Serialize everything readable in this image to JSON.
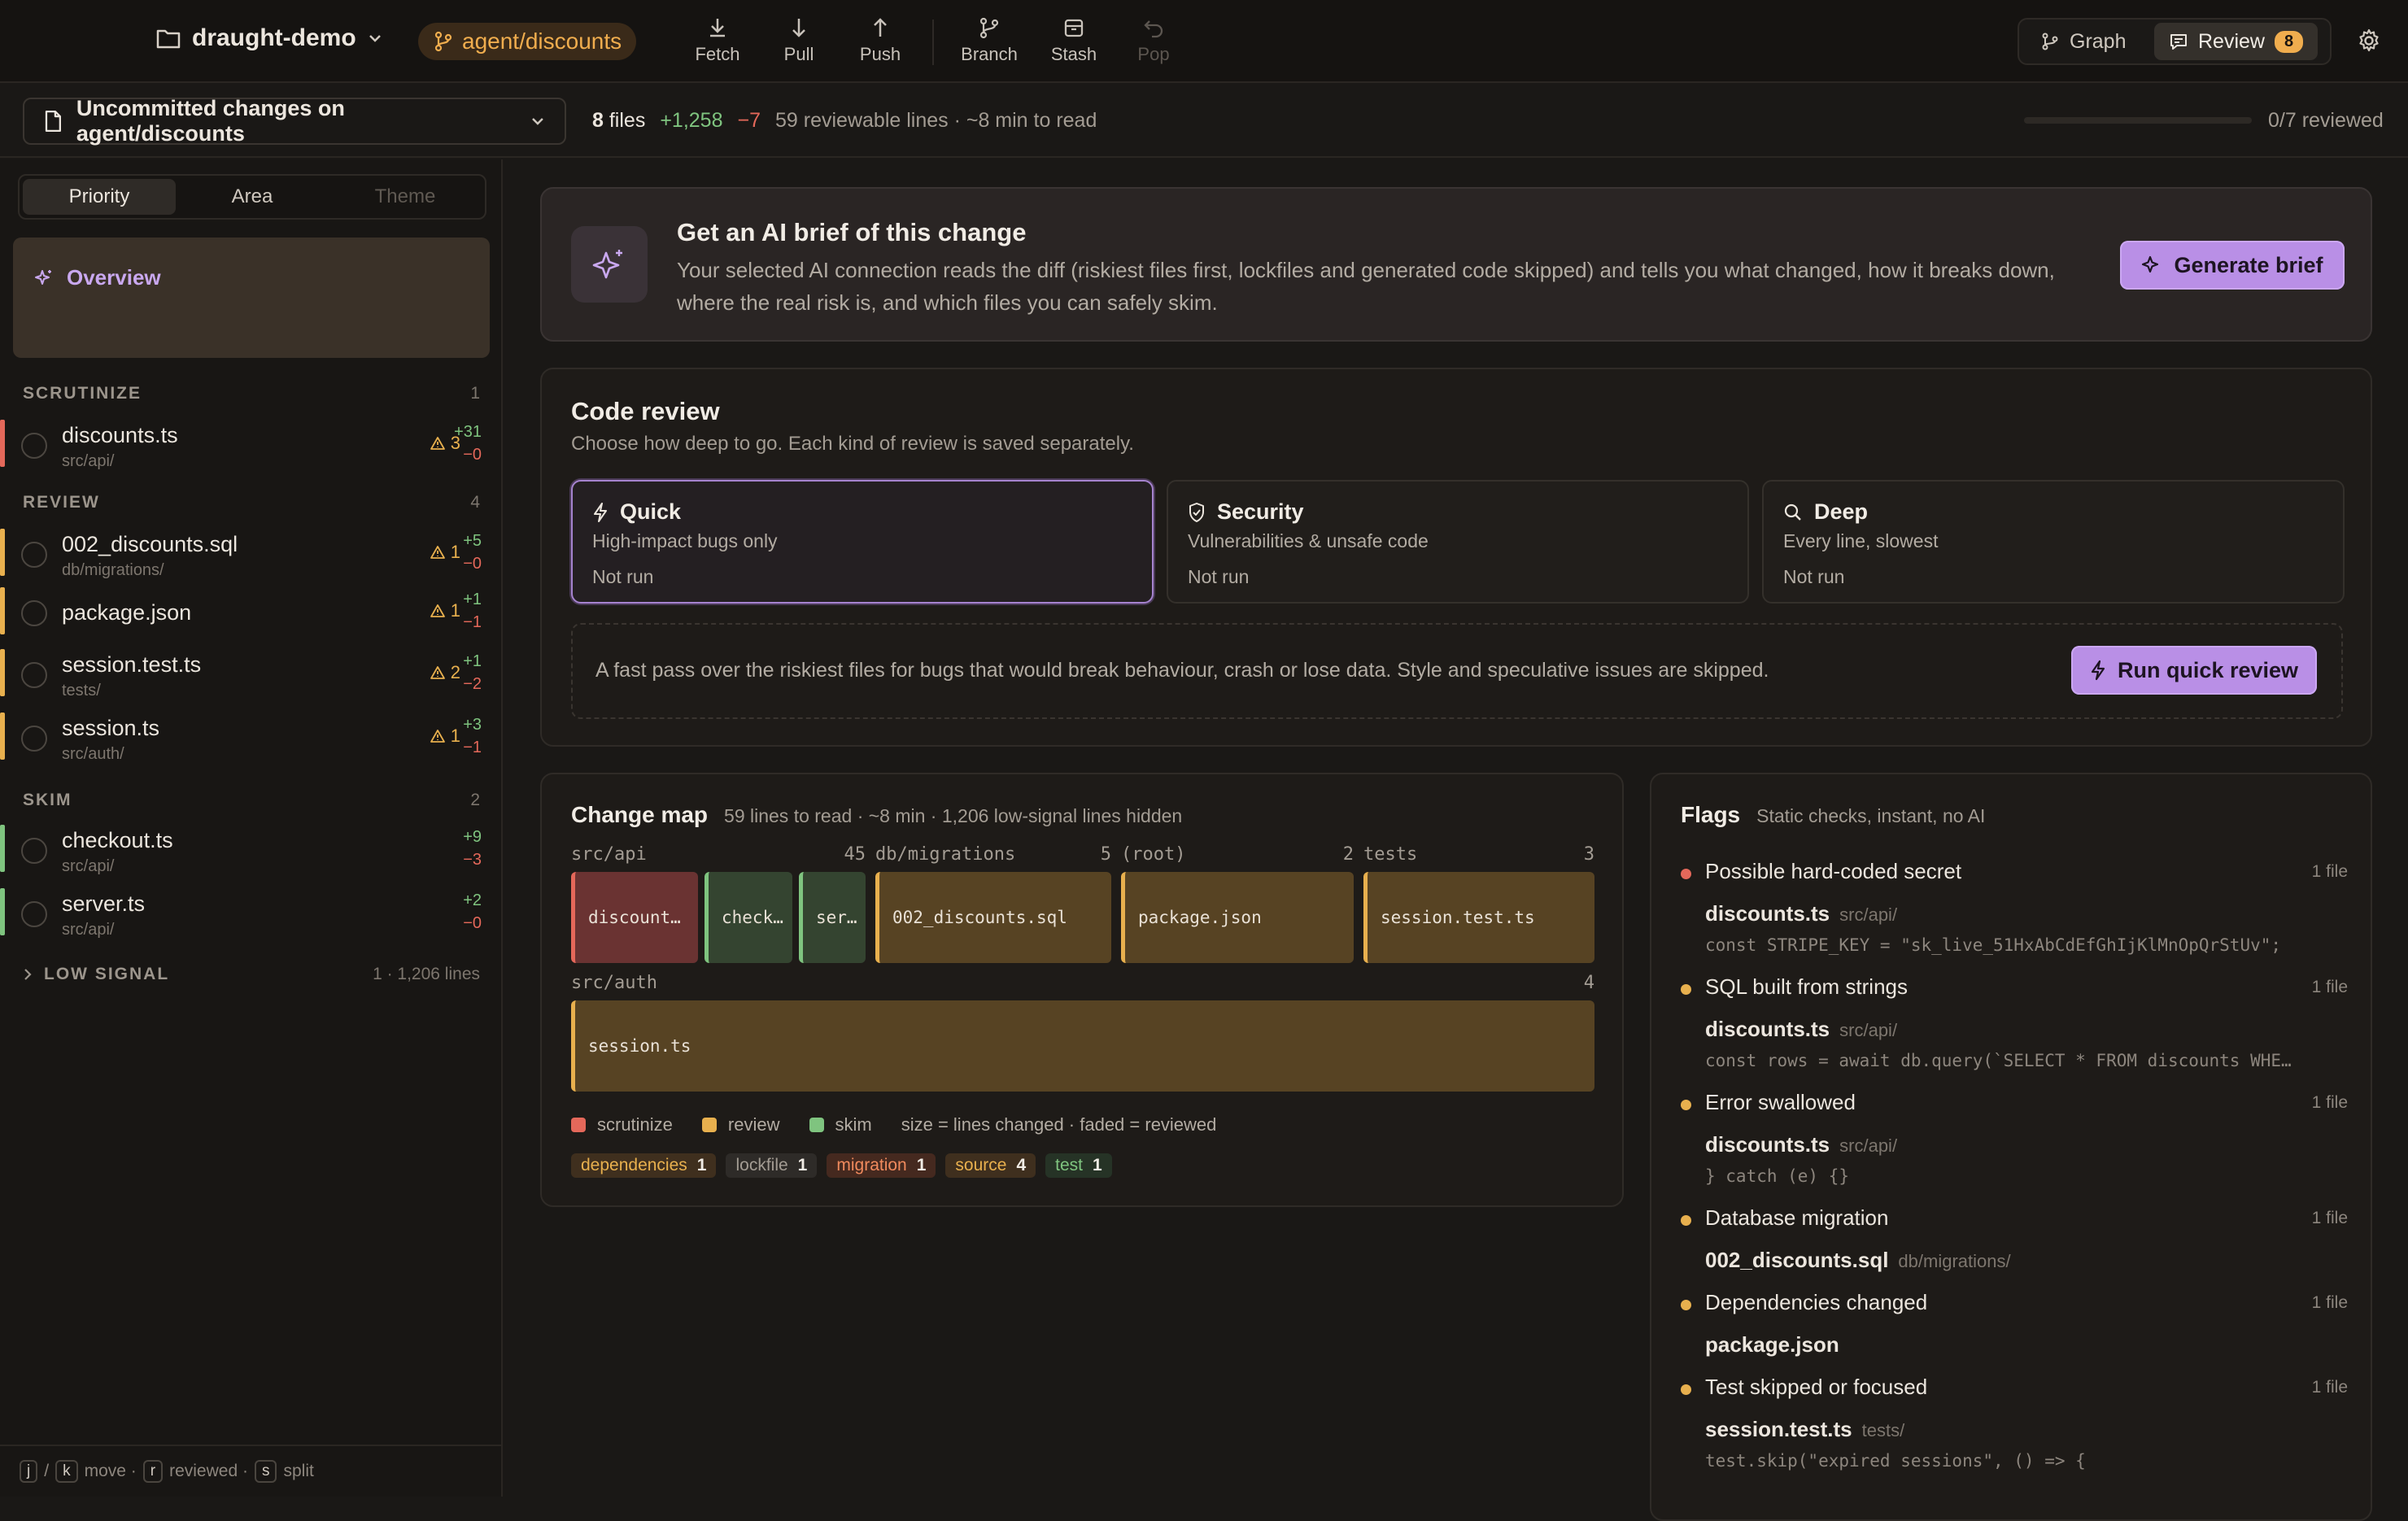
{
  "topbar": {
    "repo": "draught-demo",
    "branch": "agent/discounts",
    "tools": [
      {
        "label": "Fetch",
        "icon": "download-icon"
      },
      {
        "label": "Pull",
        "icon": "arrow-down-icon"
      },
      {
        "label": "Push",
        "icon": "arrow-up-icon"
      },
      {
        "label": "Branch",
        "icon": "branch-icon"
      },
      {
        "label": "Stash",
        "icon": "archive-icon"
      },
      {
        "label": "Pop",
        "icon": "undo-icon",
        "disabled": true
      }
    ],
    "graph_label": "Graph",
    "review_label": "Review",
    "review_badge": "8"
  },
  "subbar": {
    "changes_selector": "Uncommitted changes on agent/discounts",
    "files_count": "8",
    "files_word": "files",
    "additions": "+1,258",
    "deletions": "−7",
    "summary": "59 reviewable lines · ~8 min to read",
    "reviewed_fraction": 0,
    "reviewed_text": "0/7 reviewed"
  },
  "sidebar": {
    "tabs": [
      "Priority",
      "Area",
      "Theme"
    ],
    "overview_label": "Overview",
    "groups": [
      {
        "title": "SCRUTINIZE",
        "count": "1"
      },
      {
        "title": "REVIEW",
        "count": "4"
      },
      {
        "title": "SKIM",
        "count": "2"
      }
    ],
    "files": [
      {
        "name": "discounts.ts",
        "path": "src/api/",
        "warn": "3",
        "plus": "+31",
        "minus": "−0"
      },
      {
        "name": "002_discounts.sql",
        "path": "db/migrations/",
        "warn": "1",
        "plus": "+5",
        "minus": "−0"
      },
      {
        "name": "package.json",
        "path": "",
        "warn": "1",
        "plus": "+1",
        "minus": "−1"
      },
      {
        "name": "session.test.ts",
        "path": "tests/",
        "warn": "2",
        "plus": "+1",
        "minus": "−2"
      },
      {
        "name": "session.ts",
        "path": "src/auth/",
        "warn": "1",
        "plus": "+3",
        "minus": "−1"
      },
      {
        "name": "checkout.ts",
        "path": "src/api/",
        "warn": "",
        "plus": "+9",
        "minus": "−3"
      },
      {
        "name": "server.ts",
        "path": "src/api/",
        "warn": "",
        "plus": "+2",
        "minus": "−0"
      }
    ],
    "low_signal_label": "LOW SIGNAL",
    "low_signal_count": "1 · 1,206 lines",
    "shortcuts": {
      "k1": "j",
      "sep": "/",
      "k2": "k",
      "t1": "move ·",
      "k3": "r",
      "t2": "reviewed ·",
      "k4": "s",
      "t3": "split"
    }
  },
  "brief": {
    "title": "Get an AI brief of this change",
    "body": "Your selected AI connection reads the diff (riskiest files first, lockfiles and generated code skipped) and tells you what changed, how it breaks down, where the real risk is, and which files you can safely skim.",
    "button": "Generate brief"
  },
  "code_review": {
    "title": "Code review",
    "subtitle": "Choose how deep to go. Each kind of review is saved separately.",
    "modes": [
      {
        "name": "Quick",
        "desc": "High-impact bugs only",
        "status": "Not run"
      },
      {
        "name": "Security",
        "desc": "Vulnerabilities & unsafe code",
        "status": "Not run"
      },
      {
        "name": "Deep",
        "desc": "Every line, slowest",
        "status": "Not run"
      }
    ],
    "quick_desc": "A fast pass over the riskiest files for bugs that would break behaviour, crash or lose data. Style and speculative issues are skipped.",
    "run_button": "Run quick review"
  },
  "change_map": {
    "title": "Change map",
    "summary": "59 lines to read · ~8 min · 1,206 low-signal lines hidden",
    "dirs": [
      {
        "name": "src/api",
        "count": "45"
      },
      {
        "name": "db/migrations",
        "count": "5"
      },
      {
        "name": "(root)",
        "count": "2"
      },
      {
        "name": "tests",
        "count": "3"
      },
      {
        "name": "src/auth",
        "count": "4"
      }
    ],
    "tiles": [
      "discount…",
      "check…",
      "ser…",
      "002_discounts.sql",
      "package.json",
      "session.test.ts",
      "session.ts"
    ],
    "legend": {
      "scrutinize": "scrutinize",
      "review": "review",
      "skim": "skim",
      "note": "size = lines changed · faded = reviewed"
    },
    "chips": [
      {
        "label": "dependencies",
        "count": "1"
      },
      {
        "label": "lockfile",
        "count": "1"
      },
      {
        "label": "migration",
        "count": "1"
      },
      {
        "label": "source",
        "count": "4"
      },
      {
        "label": "test",
        "count": "1"
      }
    ]
  },
  "flags": {
    "title": "Flags",
    "subtitle": "Static checks, instant, no AI",
    "items": [
      {
        "title": "Possible hard-coded secret",
        "count": "1 file",
        "file": "discounts.ts",
        "path": "src/api/",
        "code": "const STRIPE_KEY = \"sk_live_51HxAbCdEfGhIjKlMnOpQrStUv\";",
        "color": "#e4685a"
      },
      {
        "title": "SQL built from strings",
        "count": "1 file",
        "file": "discounts.ts",
        "path": "src/api/",
        "code": "const rows = await db.query(`SELECT * FROM discounts WHE…",
        "color": "#e8b04e"
      },
      {
        "title": "Error swallowed",
        "count": "1 file",
        "file": "discounts.ts",
        "path": "src/api/",
        "code": "} catch (e) {}",
        "color": "#e8b04e"
      },
      {
        "title": "Database migration",
        "count": "1 file",
        "file": "002_discounts.sql",
        "path": "db/migrations/",
        "code": "",
        "color": "#e8b04e"
      },
      {
        "title": "Dependencies changed",
        "count": "1 file",
        "file": "package.json",
        "path": "",
        "code": "",
        "color": "#e8b04e"
      },
      {
        "title": "Test skipped or focused",
        "count": "1 file",
        "file": "session.test.ts",
        "path": "tests/",
        "code": "test.skip(\"expired sessions\", () => {",
        "color": "#e8b04e"
      }
    ]
  },
  "colors": {
    "accent": "#b98fe6",
    "scrutinize": "#e4685a",
    "review": "#e8b04e",
    "skim": "#7fc47f"
  }
}
